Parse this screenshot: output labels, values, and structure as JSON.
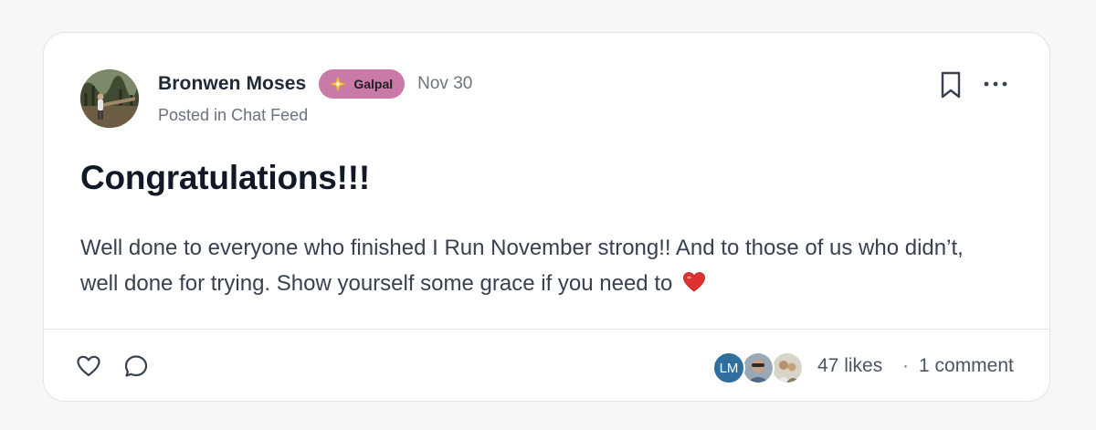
{
  "post": {
    "author": {
      "name": "Bronwen Moses",
      "avatar_icon": "user-photo-forest"
    },
    "badge": {
      "label": "Galpal",
      "icon": "sparkle-star-icon",
      "color": "#c97aa8"
    },
    "date": "Nov 30",
    "posted_in_prefix": "Posted in",
    "space": "Chat Feed",
    "title": "Congratulations!!!",
    "body": "Well done to everyone who finished I Run November strong!! And to those of us who didn’t, well done for trying. Show yourself some grace if you need to",
    "body_emoji": "red-heart-icon"
  },
  "actions": {
    "bookmark_icon": "bookmark-icon",
    "more_icon": "more-horizontal-icon",
    "like_icon": "heart-outline-icon",
    "comment_icon": "comment-bubble-icon"
  },
  "engagement": {
    "likers": [
      {
        "initials": "LM",
        "color": "#2f6f9e"
      },
      {
        "initials": "",
        "avatar_icon": "user-photo-selfie"
      },
      {
        "initials": "",
        "avatar_icon": "user-photo-group"
      }
    ],
    "likes_label": "47 likes",
    "separator": "·",
    "comments_label": "1 comment"
  }
}
